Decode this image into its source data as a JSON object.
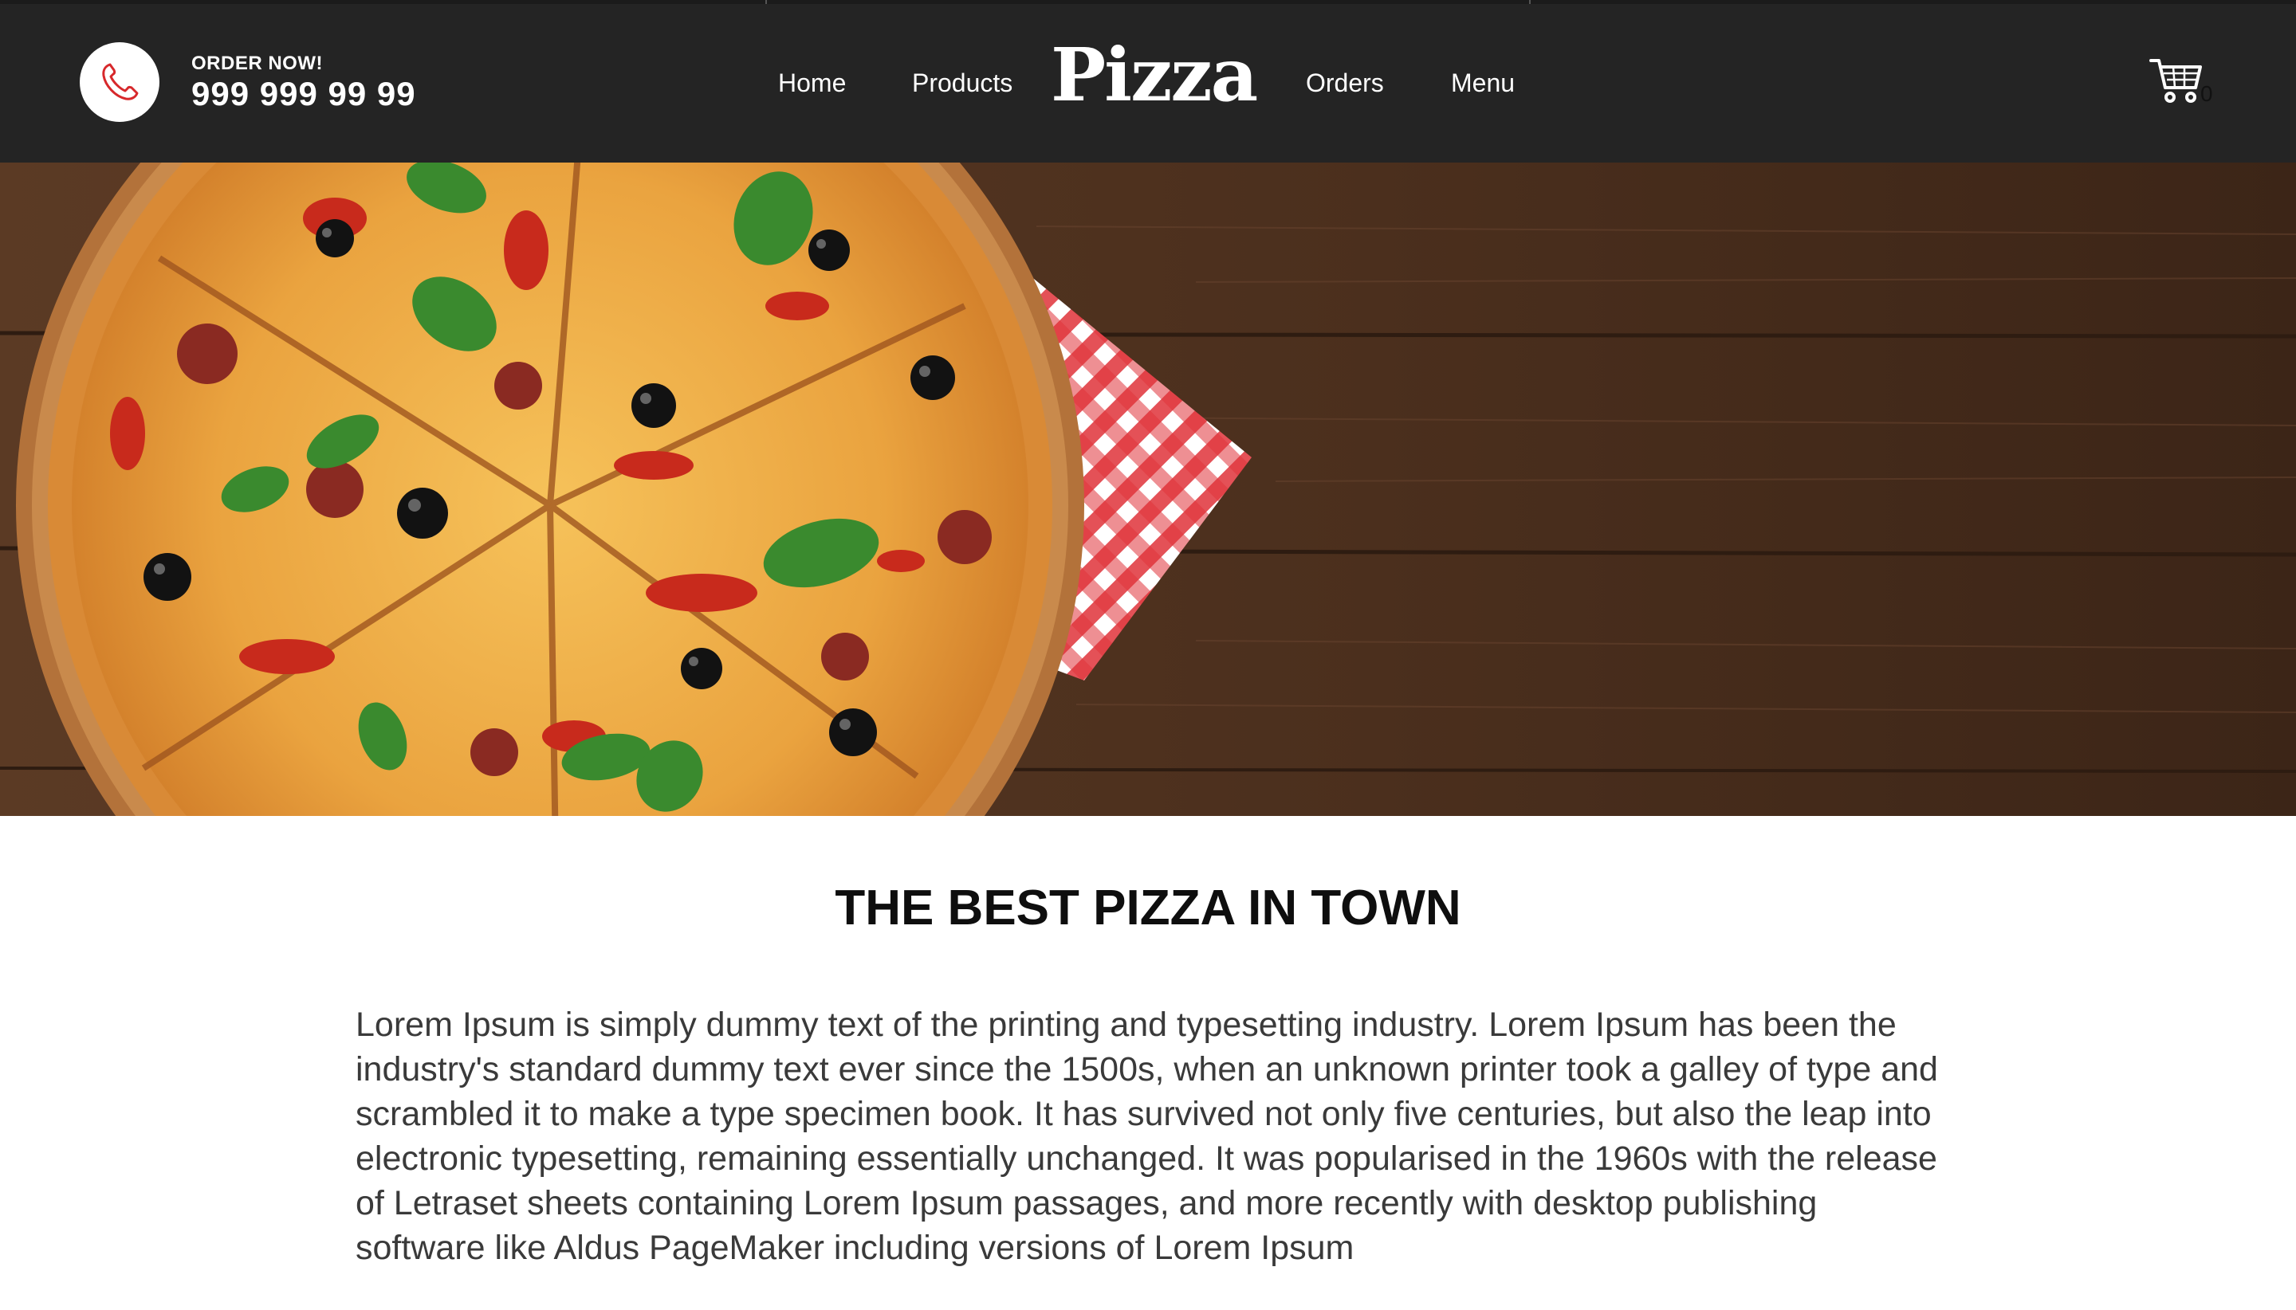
{
  "header": {
    "order_label": "ORDER NOW!",
    "phone_number": "999 999 99 99",
    "phone_icon": "phone-icon",
    "nav": [
      {
        "label": "Home"
      },
      {
        "label": "Products"
      },
      {
        "label": "Orders"
      },
      {
        "label": "Menu"
      }
    ],
    "brand": "Pizza",
    "cart_icon": "cart-icon",
    "cart_count": "0"
  },
  "hero": {
    "image": "pizza-on-wooden-table-photo"
  },
  "content": {
    "headline": "THE BEST PIZZA IN TOWN",
    "body": "Lorem Ipsum is simply dummy text of the printing and typesetting industry. Lorem Ipsum has been the industry's standard dummy text ever since the 1500s, when an unknown printer took a galley of type and scrambled it to make a type specimen book. It has survived not only five centuries, but also the leap into electronic typesetting, remaining essentially unchanged. It was popularised in the 1960s with the release of Letraset sheets containing Lorem Ipsum passages, and more recently with desktop publishing software like Aldus PageMaker including versions of Lorem Ipsum"
  },
  "colors": {
    "header_bg": "#242424",
    "accent_red": "#d7282b",
    "text_dark": "#0e0e0e",
    "text_body": "#3a3a3a"
  }
}
